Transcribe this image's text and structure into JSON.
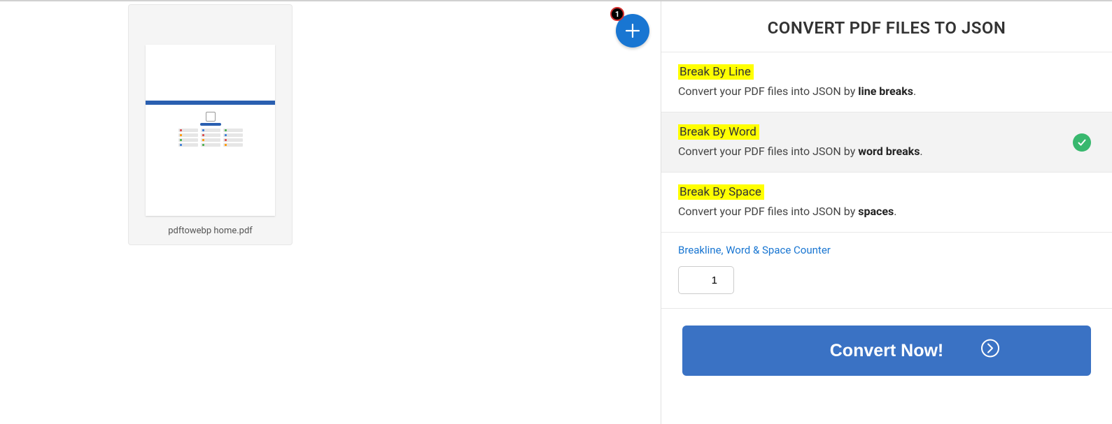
{
  "panel": {
    "title": "CONVERT PDF FILES TO JSON"
  },
  "file": {
    "name": "pdftowebp home.pdf",
    "count_badge": "1"
  },
  "options": [
    {
      "title": "Break By Line",
      "desc_prefix": "Convert your PDF files into JSON by ",
      "desc_bold": "line breaks",
      "desc_suffix": ".",
      "selected": false
    },
    {
      "title": "Break By Word",
      "desc_prefix": "Convert your PDF files into JSON by ",
      "desc_bold": "word breaks",
      "desc_suffix": ".",
      "selected": true
    },
    {
      "title": "Break By Space",
      "desc_prefix": "Convert your PDF files into JSON by ",
      "desc_bold": "spaces",
      "desc_suffix": ".",
      "selected": false
    }
  ],
  "counter": {
    "label": "Breakline, Word & Space Counter",
    "value": "1"
  },
  "actions": {
    "convert_label": "Convert Now!"
  }
}
